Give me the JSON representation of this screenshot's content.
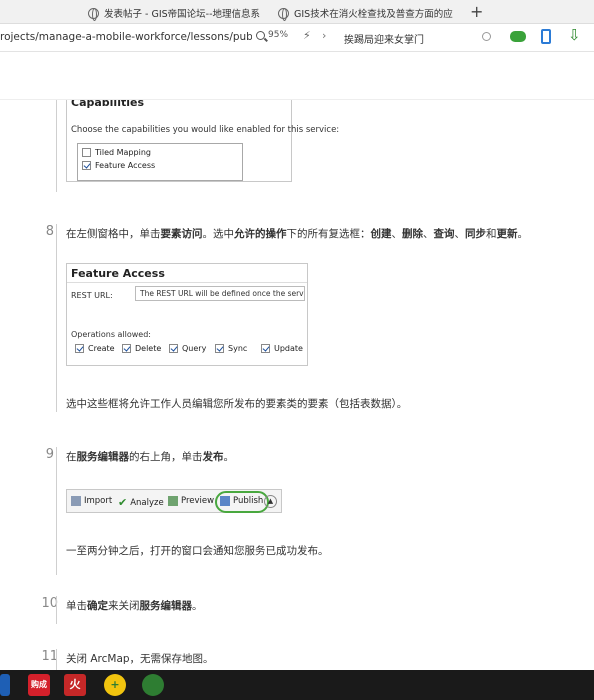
{
  "browser": {
    "tabs": [
      {
        "label": "发表帖子 - GIS帝国论坛--地理信息系"
      },
      {
        "label": "GIS技术在消火栓查找及普查方面的应"
      }
    ],
    "new_tab_glyph": "+",
    "url": "rojects/manage-a-mobile-workforce/lessons/publis",
    "zoom": "95%",
    "search_value": "挨踢局迎来女掌门"
  },
  "article": {
    "capabilities": {
      "title": "Capabilities",
      "description": "Choose the capabilities you would like enabled for this service:",
      "items": [
        {
          "label": "Tiled Mapping",
          "checked": false
        },
        {
          "label": "Feature Access",
          "checked": true
        }
      ]
    },
    "step8": {
      "num": "8",
      "t1": "在左侧窗格中，单击",
      "b1": "要素访问",
      "t2": "。选中",
      "b2": "允许的操作",
      "t3": "下的所有复选框：",
      "b3": "创建",
      "t4": "、",
      "b4": "删除",
      "t5": "、",
      "b5": "查询",
      "t6": "、",
      "b6": "同步",
      "t7": "和",
      "b7": "更新",
      "t8": "。",
      "note": "选中这些框将允许工作人员编辑您所发布的要素类的要素（包括表数据）。"
    },
    "feature_access": {
      "title": "Feature Access",
      "rest_label": "REST URL:",
      "rest_value": "The REST URL will be defined once the service is",
      "ops_label": "Operations allowed:",
      "ops": [
        {
          "label": "Create",
          "checked": true
        },
        {
          "label": "Delete",
          "checked": true
        },
        {
          "label": "Query",
          "checked": true
        },
        {
          "label": "Sync",
          "checked": true
        },
        {
          "label": "Update",
          "checked": true
        }
      ]
    },
    "step9": {
      "num": "9",
      "t1": "在",
      "b1": "服务编辑器",
      "t2": "的右上角，单击",
      "b2": "发布",
      "t3": "。",
      "note": "一至两分钟之后，打开的窗口会通知您服务已成功发布。"
    },
    "publish_bar": {
      "import": "Import",
      "analyze": "Analyze",
      "preview": "Preview",
      "publish": "Publish"
    },
    "step10": {
      "num": "10",
      "t1": "单击",
      "b1": "确定",
      "t2": "来关闭",
      "b2": "服务编辑器",
      "t3": "。"
    },
    "step11": {
      "num": "11",
      "t1": "关闭 ArcMap，无需保存地图。"
    }
  },
  "taskbar": {
    "icons": [
      {
        "name": "app-red",
        "label": "购成",
        "color": "#d4202b"
      },
      {
        "name": "app-fire",
        "label": "火",
        "color": "#c62828"
      },
      {
        "name": "app-plus",
        "label": "+",
        "color": "#f1c40f"
      },
      {
        "name": "app-browser",
        "label": "",
        "color": "#2e7d32"
      }
    ]
  }
}
